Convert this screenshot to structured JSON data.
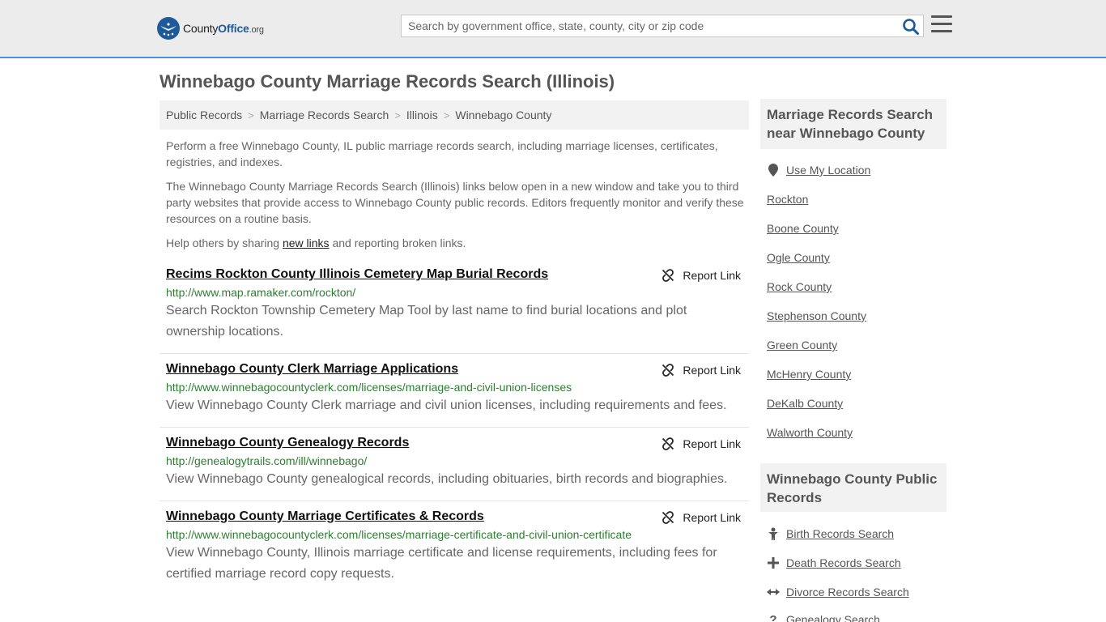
{
  "header": {
    "logo": {
      "county": "County",
      "office": "Office",
      "tld": ".org"
    },
    "search_placeholder": "Search by government office, state, county, city or zip code"
  },
  "page_title": "Winnebago County Marriage Records Search (Illinois)",
  "breadcrumb": [
    "Public Records",
    "Marriage Records Search",
    "Illinois",
    "Winnebago County"
  ],
  "intro": {
    "p1": "Perform a free Winnebago County, IL public marriage records search, including marriage licenses, certificates, registries, and indexes.",
    "p2": "The Winnebago County Marriage Records Search (Illinois) links below open in a new window and take you to third party websites that provide access to Winnebago County public records. Editors frequently monitor and verify these resources on a routine basis.",
    "p3_before": "Help others by sharing ",
    "p3_link": "new links",
    "p3_after": " and reporting broken links."
  },
  "report_label": "Report Link",
  "results": [
    {
      "title": "Recims Rockton County Illinois Cemetery Map Burial Records",
      "url": "http://www.map.ramaker.com/rockton/",
      "desc": "Search Rockton Township Cemetery Map Tool by last name to find burial locations and plot ownership locations."
    },
    {
      "title": "Winnebago County Clerk Marriage Applications",
      "url": "http://www.winnebagocountyclerk.com/licenses/marriage-and-civil-union-licenses",
      "desc": "View Winnebago County Clerk marriage and civil union licenses, including requirements and fees."
    },
    {
      "title": "Winnebago County Genealogy Records",
      "url": "http://genealogytrails.com/ill/winnebago/",
      "desc": "View Winnebago County genealogical records, including obituaries, birth records and biographies."
    },
    {
      "title": "Winnebago County Marriage Certificates & Records",
      "url": "http://www.winnebagocountyclerk.com/licenses/marriage-certificate-and-civil-union-certificate",
      "desc": "View Winnebago County, Illinois marriage certificate and license requirements, including fees for certified marriage record copy requests."
    }
  ],
  "sidebar": {
    "nearby_title": "Marriage Records Search near Winnebago County",
    "use_location": "Use My Location",
    "nearby": [
      "Rockton",
      "Boone County",
      "Ogle County",
      "Rock County",
      "Stephenson County",
      "Green County",
      "McHenry County",
      "DeKalb County",
      "Walworth County"
    ],
    "public_title": "Winnebago County Public Records",
    "public_links": [
      "Birth Records Search",
      "Death Records Search",
      "Divorce Records Search",
      "Genealogy Search"
    ]
  },
  "colors": {
    "accent": "#1e5a9a",
    "url_green": "#2e7d32",
    "header_bg": "#ececec",
    "header_border": "#4a90d9"
  }
}
